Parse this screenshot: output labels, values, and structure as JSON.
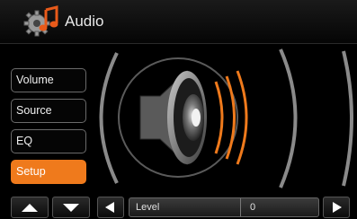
{
  "header": {
    "title": "Audio",
    "icon": "gear-music-note-icon"
  },
  "menu": {
    "items": [
      {
        "label": "Volume",
        "active": false
      },
      {
        "label": "Source",
        "active": false
      },
      {
        "label": "EQ",
        "active": false
      },
      {
        "label": "Setup",
        "active": true
      }
    ]
  },
  "illustration": {
    "icon": "speaker-icon",
    "accent_color": "#ef7a1c"
  },
  "bottom_bar": {
    "up_icon": "triangle-up-icon",
    "down_icon": "triangle-down-icon",
    "left_icon": "triangle-left-icon",
    "right_icon": "triangle-right-icon",
    "level_label": "Level",
    "level_value": "0"
  },
  "colors": {
    "accent": "#ef7a1c",
    "background": "#000000",
    "border": "#6a6a6a"
  }
}
